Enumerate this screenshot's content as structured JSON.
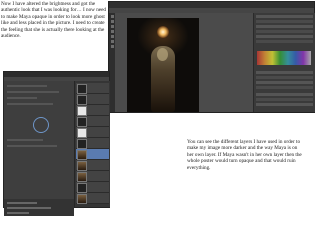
{
  "notes": {
    "top": "Now I have altered the brightness and got the authentic look that I was looking for… I now need to make Maya opaque in order to look more ghost like and less placed in the picture. I need to create the feeling that she is actually there looking at the audience.",
    "bottom": "You can see the different layers I have used in order to make my image more darker and the way Maya is on her own layer. If Maya wasn't in her own layer then the whole poster would turn opaque and that would ruin everything."
  },
  "colors": {
    "ps_dark": "#3b3b3b",
    "ps_panel": "#3a3a3a",
    "selected_layer": "#5a7bb0",
    "photo_background": "#0e0c0a",
    "lamp_glow": "#f0b860"
  },
  "icons": [
    "selection-circle-icon"
  ]
}
